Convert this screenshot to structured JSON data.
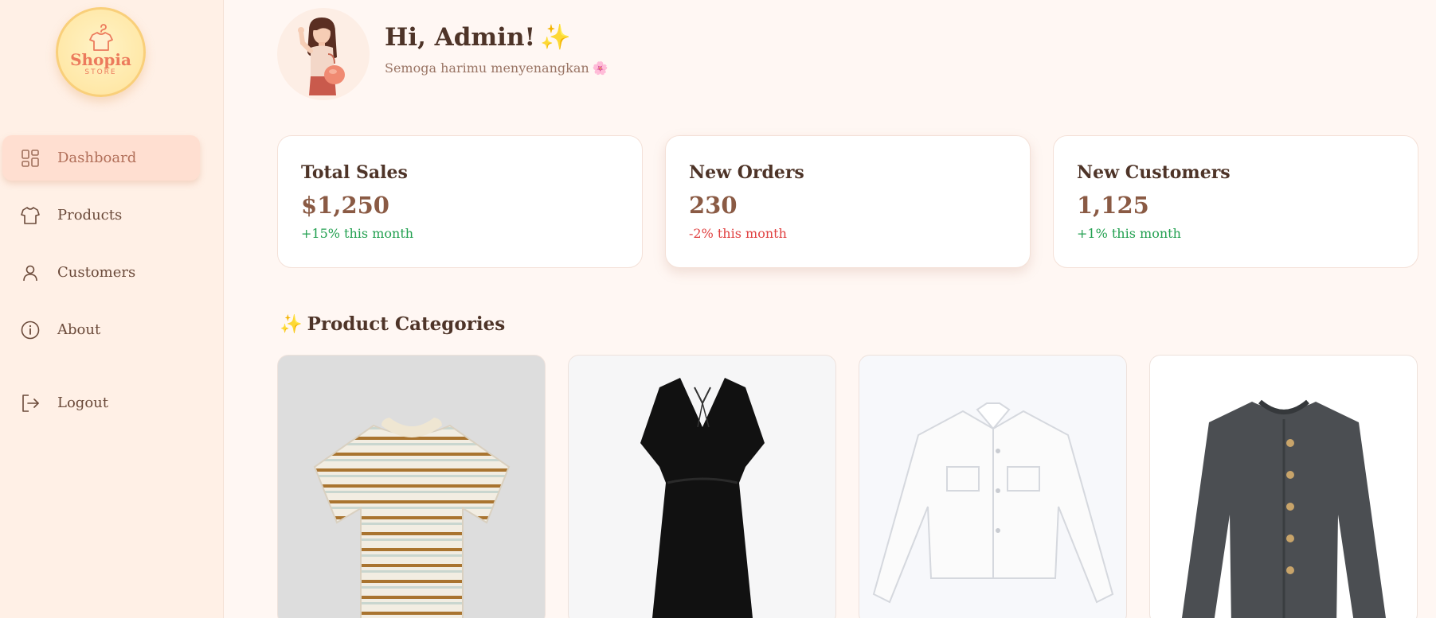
{
  "logo": {
    "title": "Shopia",
    "subtitle": "STORE"
  },
  "sidebar": {
    "items": [
      {
        "label": "Dashboard",
        "icon": "dashboard-icon",
        "active": true
      },
      {
        "label": "Products",
        "icon": "shirt-icon",
        "active": false
      },
      {
        "label": "Customers",
        "icon": "user-icon",
        "active": false
      },
      {
        "label": "About",
        "icon": "info-icon",
        "active": false
      },
      {
        "label": "Logout",
        "icon": "logout-icon",
        "active": false
      }
    ]
  },
  "header": {
    "greeting": "Hi, Admin!",
    "sparkle": "✨",
    "subtitle": "Semoga harimu menyenangkan",
    "flower": "🌸"
  },
  "stats": [
    {
      "title": "Total Sales",
      "value": "$1,250",
      "change": "+15% this month",
      "trend": "up"
    },
    {
      "title": "New Orders",
      "value": "230",
      "change": "-2% this month",
      "trend": "down"
    },
    {
      "title": "New Customers",
      "value": "1,125",
      "change": "+1% this month",
      "trend": "up"
    }
  ],
  "categories": {
    "title": "Product Categories",
    "sparkle": "✨",
    "items": [
      {
        "image": "striped-tshirt"
      },
      {
        "image": "black-dress"
      },
      {
        "image": "white-denim-jacket"
      },
      {
        "image": "grey-cardigan"
      }
    ]
  },
  "colors": {
    "accent": "#ec7a5c",
    "sidebar_bg": "#fff0e6",
    "active_bg": "#ffdfd1",
    "positive": "#22a050",
    "negative": "#e04040"
  }
}
